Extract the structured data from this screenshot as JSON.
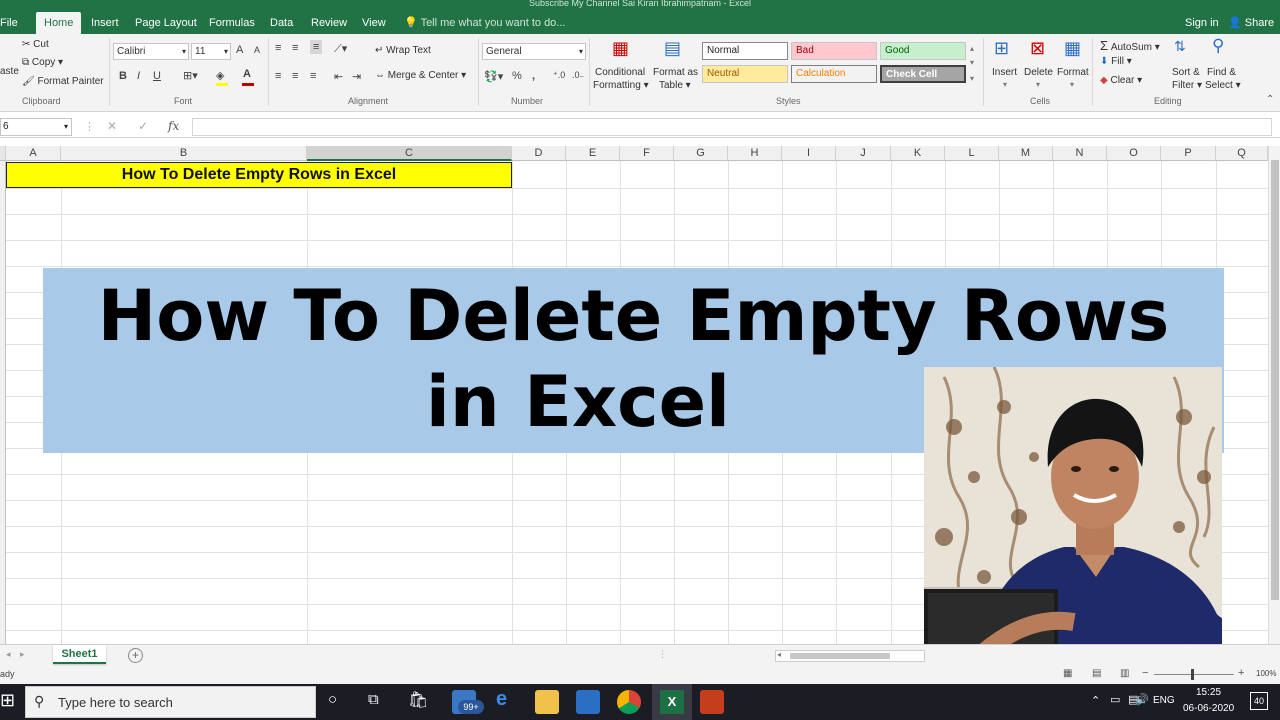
{
  "window": {
    "title": "Subscribe My Channel Sai Kiran Ibrahimpatnam - Excel"
  },
  "ribbon_tabs": [
    "File",
    "Home",
    "Insert",
    "Page Layout",
    "Formulas",
    "Data",
    "Review",
    "View"
  ],
  "tell_me": "Tell me what you want to do...",
  "account": {
    "sign_in": "Sign in",
    "share": "Share"
  },
  "clipboard": {
    "paste": "aste",
    "cut": "Cut",
    "copy": "Copy",
    "format_painter": "Format Painter",
    "group": "Clipboard"
  },
  "font": {
    "name": "Calibri",
    "size": "11",
    "bold": "B",
    "italic": "I",
    "underline": "U",
    "increase": "A",
    "decrease": "A",
    "font_color": "A",
    "group": "Font"
  },
  "alignment": {
    "wrap_text": "Wrap Text",
    "merge_center": "Merge & Center",
    "group": "Alignment"
  },
  "number": {
    "format": "General",
    "percent": "%",
    "comma": ",",
    "group": "Number"
  },
  "styles": {
    "conditional_1": "Conditional",
    "conditional_2": "Formatting",
    "format_as_1": "Format as",
    "format_as_2": "Table",
    "normal": "Normal",
    "bad": "Bad",
    "good": "Good",
    "neutral": "Neutral",
    "calculation": "Calculation",
    "check_cell": "Check Cell",
    "group": "Styles"
  },
  "cells": {
    "insert": "Insert",
    "delete": "Delete",
    "format": "Format",
    "group": "Cells"
  },
  "editing": {
    "autosum": "AutoSum",
    "fill": "Fill",
    "clear": "Clear",
    "sort_1": "Sort &",
    "sort_2": "Filter",
    "find_1": "Find &",
    "find_2": "Select",
    "group": "Editing"
  },
  "formula_bar": {
    "name_box": "6",
    "fx": "fx",
    "cancel": "✕",
    "enter": "✓"
  },
  "columns": [
    "A",
    "B",
    "C",
    "D",
    "E",
    "F",
    "G",
    "H",
    "I",
    "J",
    "K",
    "L",
    "M",
    "N",
    "O",
    "P",
    "Q"
  ],
  "cell_title": "How To Delete Empty Rows in Excel",
  "overlay": {
    "line1": "How To Delete Empty Rows",
    "line2": "in Excel"
  },
  "sheet": {
    "tab": "Sheet1",
    "add": "+"
  },
  "status": {
    "ready": "ady",
    "zoom": "100%"
  },
  "taskbar": {
    "search": "Type here to search",
    "mail_badge": "99+",
    "lang": "ENG",
    "time": "15:25",
    "date": "06-06-2020",
    "notif": "40"
  },
  "colors": {
    "excel_green": "#217346",
    "cell_yellow": "#ffff00",
    "banner_blue": "#a8c9e8"
  }
}
